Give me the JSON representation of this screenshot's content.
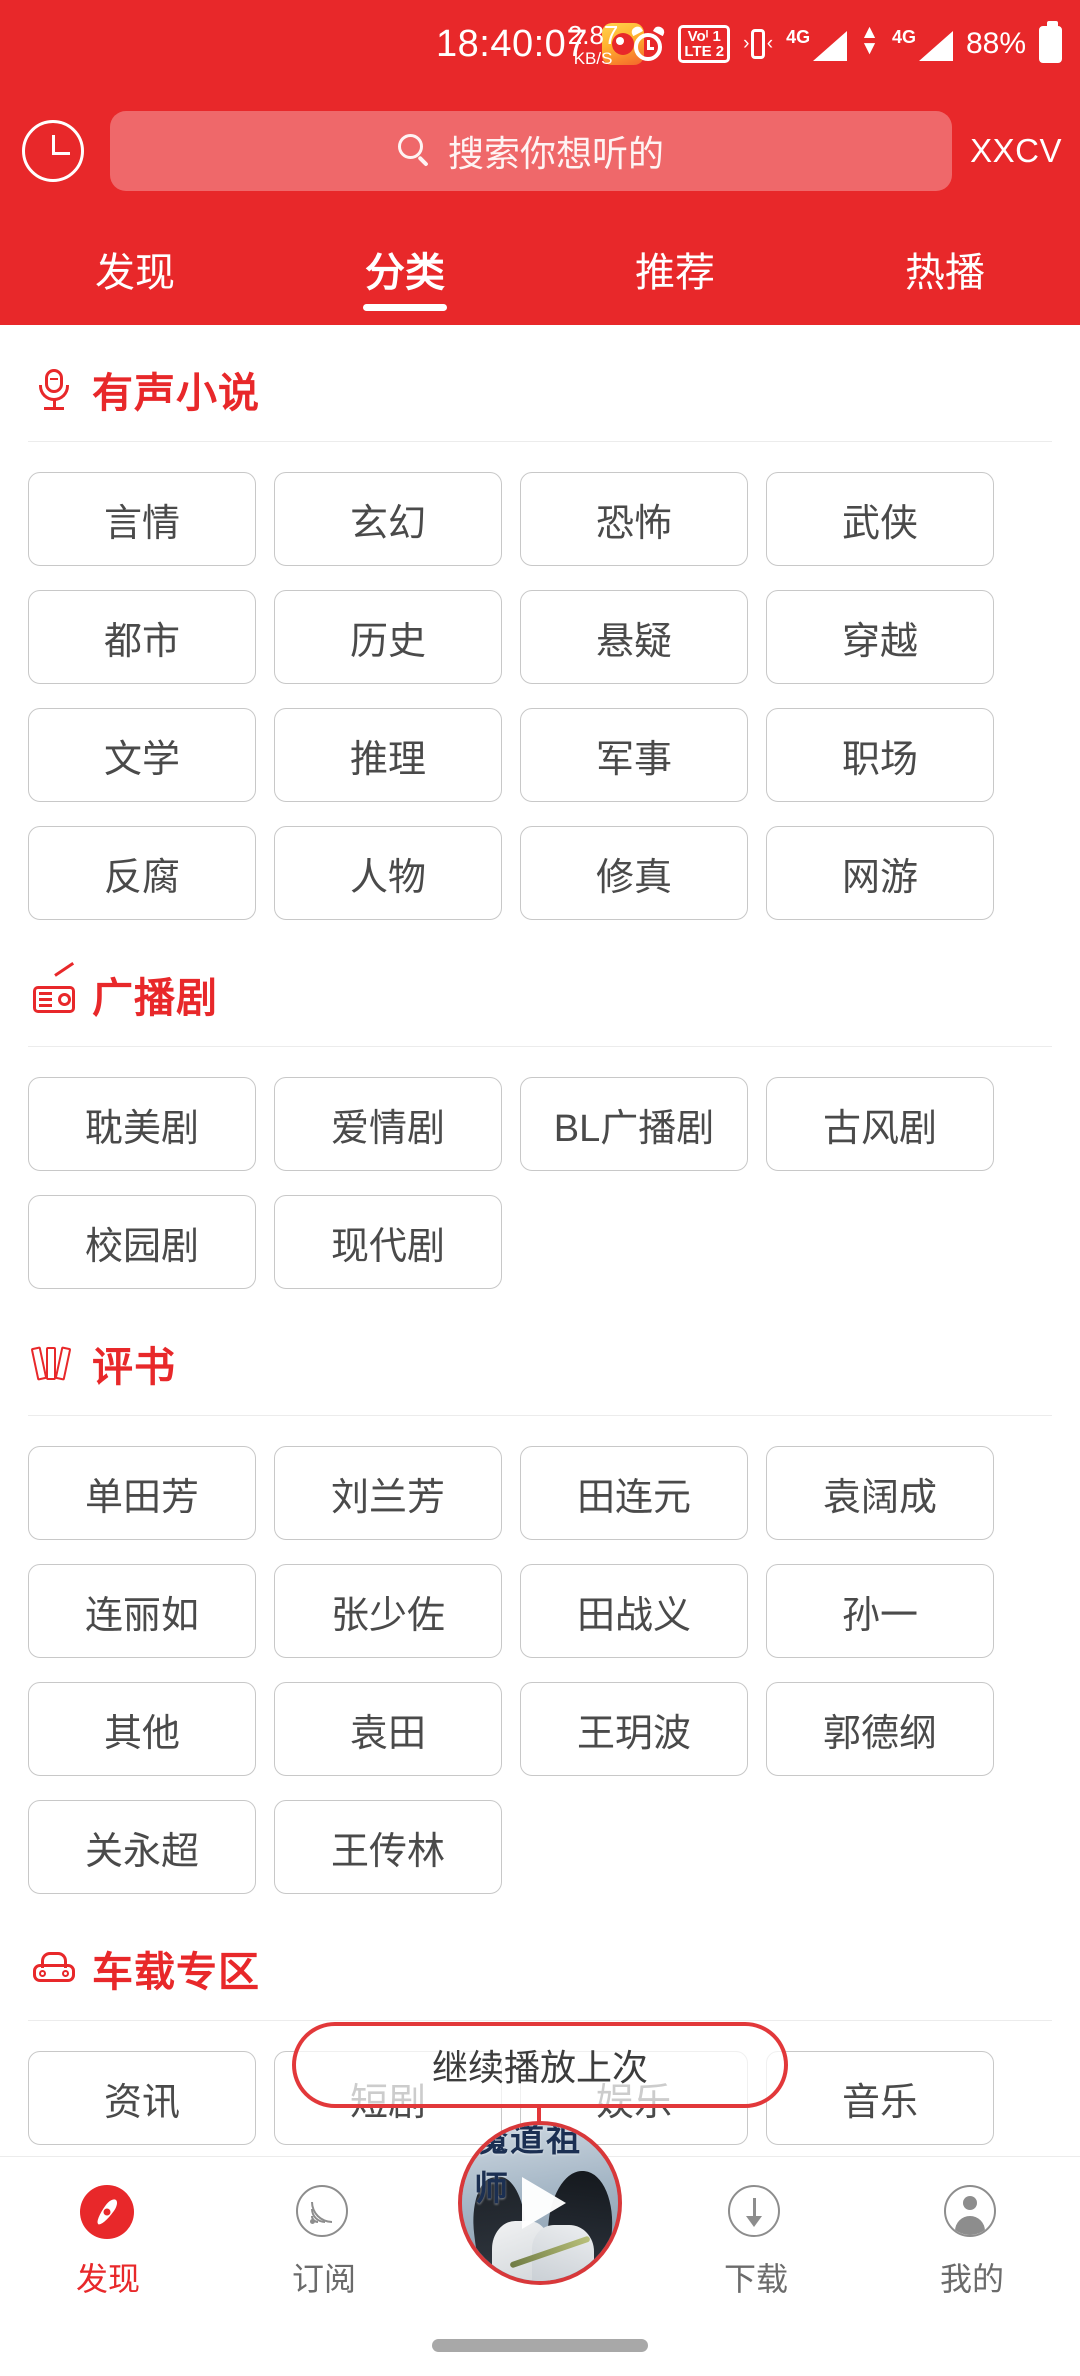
{
  "statusbar": {
    "clock": "18:40:07",
    "weibo_icon": "weibo-app-icon",
    "netspeed_value": "2.87",
    "netspeed_unit": "KB/S",
    "alarm_icon": "alarm-clock-icon",
    "volte_top": "Voᴵ 1",
    "volte_bottom": "LTE 2",
    "vibrate_icon": "vibrate-icon",
    "sim1_net": "4G",
    "sim2_net": "4G",
    "battery_percent": "88%"
  },
  "header": {
    "history_icon": "history-clock-icon",
    "search_icon": "search-icon",
    "search_placeholder": "搜索你想听的",
    "user_label": "XXCV",
    "accent_color": "#E8282A",
    "tabs": [
      {
        "label": "发现",
        "active": false
      },
      {
        "label": "分类",
        "active": true
      },
      {
        "label": "推荐",
        "active": false
      },
      {
        "label": "热播",
        "active": false
      }
    ]
  },
  "sections": [
    {
      "title": "有声小说",
      "icon": "microphone-icon",
      "chips": [
        "言情",
        "玄幻",
        "恐怖",
        "武侠",
        "都市",
        "历史",
        "悬疑",
        "穿越",
        "文学",
        "推理",
        "军事",
        "职场",
        "反腐",
        "人物",
        "修真",
        "网游"
      ]
    },
    {
      "title": "广播剧",
      "icon": "radio-icon",
      "chips": [
        "耽美剧",
        "爱情剧",
        "BL广播剧",
        "古风剧",
        "校园剧",
        "现代剧"
      ]
    },
    {
      "title": "评书",
      "icon": "storybook-icon",
      "chips": [
        "单田芳",
        "刘兰芳",
        "田连元",
        "袁阔成",
        "连丽如",
        "张少佐",
        "田战义",
        "孙一",
        "其他",
        "袁田",
        "王玥波",
        "郭德纲",
        "关永超",
        "王传林"
      ]
    },
    {
      "title": "车载专区",
      "icon": "car-icon",
      "chips": [
        "资讯",
        "短剧",
        "娱乐",
        "音乐",
        "",
        "",
        "",
        ""
      ]
    }
  ],
  "resume_pill": {
    "label": "继续播放上次",
    "border_color": "#E2383A"
  },
  "player": {
    "album_title": "魔道祖师",
    "play_icon": "play-triangle-icon"
  },
  "bottomnav": [
    {
      "label": "发现",
      "icon": "compass-icon",
      "active": true
    },
    {
      "label": "订阅",
      "icon": "rss-icon",
      "active": false
    },
    {
      "label": "下载",
      "icon": "download-icon",
      "active": false
    },
    {
      "label": "我的",
      "icon": "user-icon",
      "active": false
    }
  ]
}
